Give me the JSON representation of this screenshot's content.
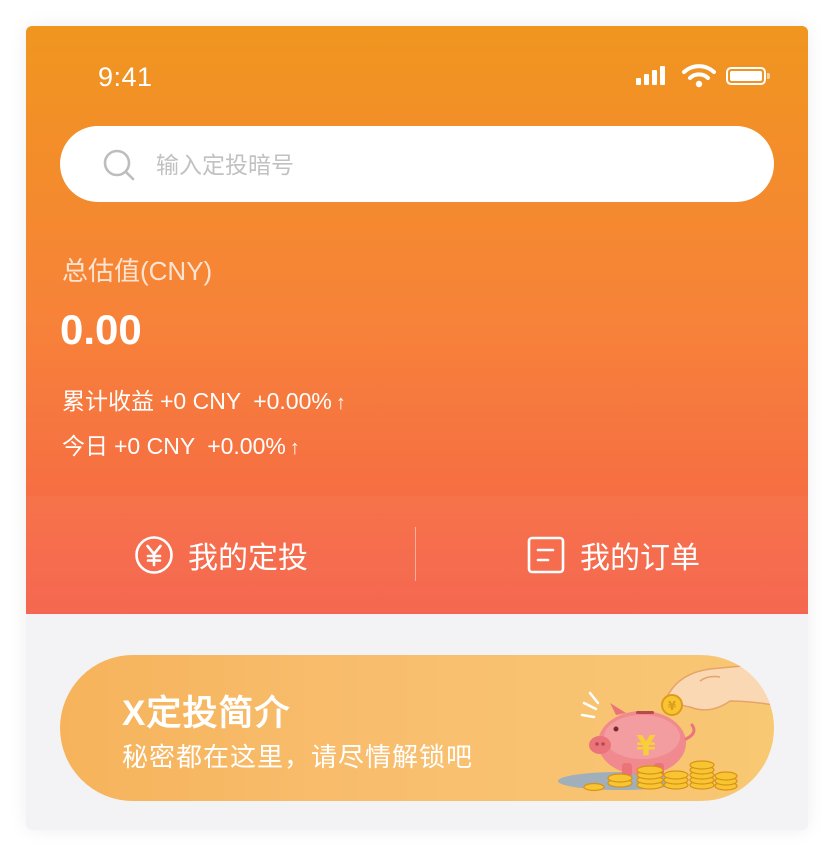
{
  "status_bar": {
    "time": "9:41"
  },
  "search": {
    "placeholder": "输入定投暗号",
    "value": ""
  },
  "total": {
    "label": "总估值(CNY)",
    "value": "0.00"
  },
  "cumulative": {
    "label": "累计收益",
    "amount": "+0 CNY",
    "percent": "+0.00%",
    "arrow": "↑"
  },
  "today": {
    "label": "今日",
    "amount": "+0 CNY",
    "percent": "+0.00%",
    "arrow": "↑"
  },
  "actions": [
    {
      "label": "我的定投",
      "icon": "yuan-circle-icon"
    },
    {
      "label": "我的订单",
      "icon": "order-document-icon"
    }
  ],
  "banner": {
    "title": "X定投简介",
    "subtitle": "秘密都在这里，请尽情解锁吧",
    "illustration": "piggy-bank-coins-icon"
  },
  "colors": {
    "gradient_top": "#f0961f",
    "gradient_bottom": "#f5614a",
    "banner_left": "#f6b35b",
    "banner_right": "#f8c873",
    "background": "#f3f3f5"
  }
}
